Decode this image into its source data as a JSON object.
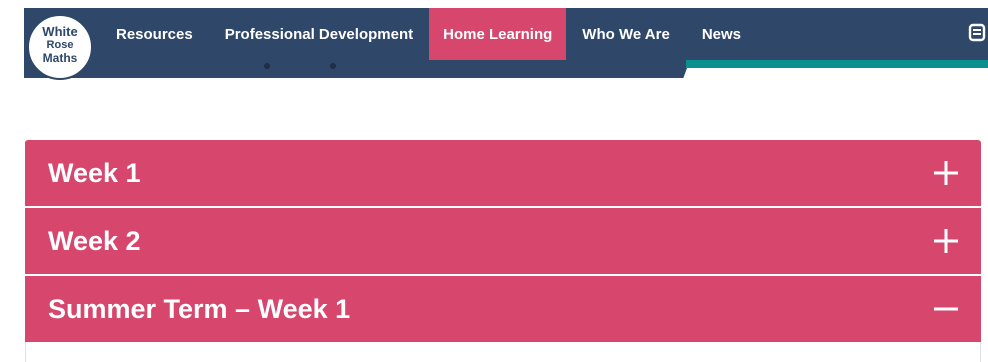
{
  "logo": {
    "line1": "White",
    "line2": "Rose",
    "line3": "Maths"
  },
  "nav": {
    "items": [
      {
        "label": "Resources",
        "active": false
      },
      {
        "label": "Professional Development",
        "active": false
      },
      {
        "label": "Home Learning",
        "active": true
      },
      {
        "label": "Who We Are",
        "active": false
      },
      {
        "label": "News",
        "active": false
      }
    ]
  },
  "accordion": {
    "items": [
      {
        "title": "Week 1",
        "expanded": false,
        "icon": "plus-icon"
      },
      {
        "title": "Week 2",
        "expanded": false,
        "icon": "plus-icon"
      },
      {
        "title": "Summer Term – Week 1",
        "expanded": true,
        "icon": "minus-icon"
      }
    ]
  },
  "colors": {
    "navy": "#2f4768",
    "pink": "#d6466d",
    "teal": "#0b8f90"
  }
}
